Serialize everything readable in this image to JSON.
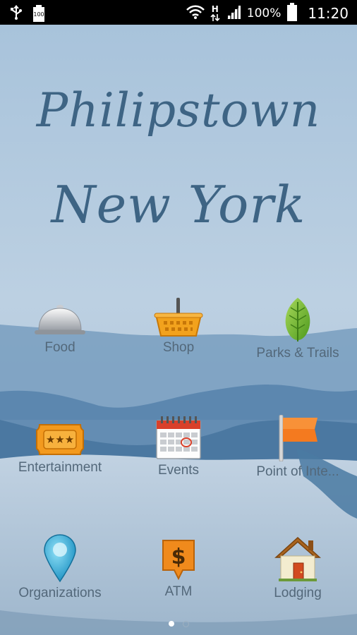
{
  "status_bar": {
    "battery_badge": "100",
    "network_type": "H",
    "battery_percent": "100%",
    "time": "11:20",
    "icons": [
      "usb-icon",
      "battery-saver-icon",
      "wifi-icon",
      "data-arrows-icon",
      "signal-icon",
      "battery-icon"
    ]
  },
  "header": {
    "title_line1": "Philipstown",
    "title_line2": "New York"
  },
  "tiles": [
    {
      "label": "Food",
      "icon": "cloche-icon"
    },
    {
      "label": "Shop",
      "icon": "basket-icon"
    },
    {
      "label": "Parks & Trails",
      "icon": "leaf-icon"
    },
    {
      "label": "Entertainment",
      "icon": "ticket-icon"
    },
    {
      "label": "Events",
      "icon": "calendar-icon"
    },
    {
      "label": "Point of Inte...",
      "icon": "flag-icon"
    },
    {
      "label": "Organizations",
      "icon": "map-pin-icon"
    },
    {
      "label": "ATM",
      "icon": "dollar-sign-icon"
    },
    {
      "label": "Lodging",
      "icon": "house-icon"
    }
  ],
  "pager": {
    "current_page": 1,
    "total_pages": 2
  },
  "colors": {
    "title": "#3e6484",
    "label": "#53687a",
    "sky": "#9fbed8",
    "mountains": "#4d7ea8"
  }
}
